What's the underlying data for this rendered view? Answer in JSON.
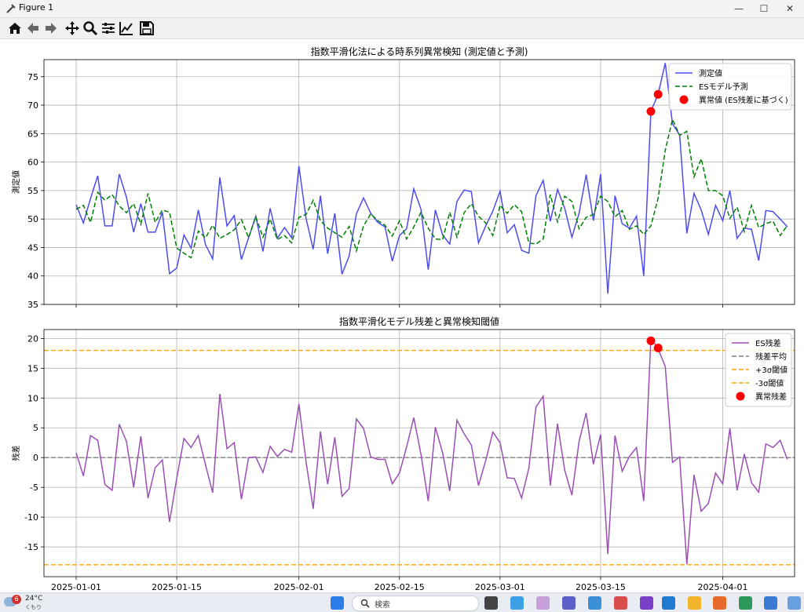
{
  "window": {
    "title": "Figure 1"
  },
  "toolbar": {
    "buttons": [
      "home-icon",
      "back-icon",
      "forward-icon",
      "pan-icon",
      "zoom-icon",
      "configure-subplots-icon",
      "edit-axis-icon",
      "save-icon"
    ]
  },
  "taskbar": {
    "weather_temp": "24°C",
    "weather_desc": "くもり",
    "weather_badge": "6",
    "search_placeholder": "検索"
  },
  "chart_data": [
    {
      "type": "line",
      "title": "指数平滑化法による時系列異常検知 (測定値と予測)",
      "ylabel": "測定値",
      "xlabel": "",
      "ylim": [
        35,
        78
      ],
      "yticks": [
        35,
        40,
        45,
        50,
        55,
        60,
        65,
        70,
        75
      ],
      "xticks": [
        "2025-01-01",
        "2025-01-15",
        "2025-02-01",
        "2025-02-15",
        "2025-03-01",
        "2025-03-15",
        "2025-04-01"
      ],
      "x_start": "2025-01-01",
      "legend_position": "top-right",
      "grid": true,
      "series": [
        {
          "name": "測定値",
          "color": "#4c4cf0",
          "style": "solid",
          "values": [
            52.5,
            49.3,
            53.6,
            57.6,
            48.8,
            48.8,
            57.9,
            53.8,
            47.7,
            52.7,
            47.7,
            47.7,
            51.2,
            40.4,
            41.4,
            47.2,
            44.9,
            51.6,
            45.5,
            43.0,
            57.3,
            48.8,
            50.6,
            42.9,
            46.7,
            50.5,
            44.3,
            51.9,
            46.6,
            48.5,
            46.7,
            59.3,
            50.1,
            44.7,
            54.1,
            43.9,
            51.0,
            40.3,
            43.5,
            50.9,
            53.7,
            51.0,
            49.4,
            48.6,
            42.6,
            47.1,
            48.3,
            55.3,
            51.7,
            41.1,
            51.6,
            47.2,
            45.6,
            53.1,
            55.1,
            54.8,
            45.8,
            48.8,
            51.4,
            54.9,
            47.6,
            49.0,
            44.5,
            44.0,
            54.1,
            56.8,
            49.6,
            55.2,
            51.9,
            46.8,
            51.0,
            57.8,
            49.7,
            57.9,
            36.9,
            54.1,
            49.2,
            48.4,
            50.5,
            40.0,
            68.9,
            71.9,
            77.4,
            66.7,
            64.8,
            47.5,
            54.5,
            51.6,
            47.3,
            52.4,
            49.7,
            55.0,
            46.6,
            48.4,
            48.2,
            42.7,
            51.5,
            51.3,
            50.0,
            48.6
          ]
        },
        {
          "name": "ESモデル予測",
          "color": "#008000",
          "style": "dashed",
          "values": [
            51.7,
            52.4,
            49.4,
            54.7,
            53.3,
            54.3,
            52.3,
            51.1,
            52.7,
            49.1,
            54.5,
            49.4,
            51.6,
            51.2,
            44.9,
            44.0,
            43.2,
            47.9,
            46.7,
            48.9,
            46.6,
            47.3,
            48.1,
            49.9,
            46.7,
            50.4,
            46.8,
            50.0,
            46.4,
            47.1,
            45.8,
            50.3,
            50.8,
            53.3,
            49.7,
            48.4,
            47.6,
            46.8,
            48.7,
            44.4,
            48.8,
            50.9,
            49.7,
            48.9,
            47.0,
            49.7,
            46.5,
            48.6,
            51.2,
            48.4,
            46.5,
            46.4,
            51.2,
            46.8,
            51.1,
            52.7,
            50.5,
            49.3,
            47.1,
            52.4,
            51.0,
            52.5,
            51.3,
            45.8,
            45.6,
            46.5,
            54.3,
            49.5,
            54.0,
            53.1,
            48.3,
            50.3,
            50.8,
            54.0,
            53.1,
            50.4,
            51.5,
            48.2,
            48.8,
            47.3,
            48.8,
            53.6,
            62.1,
            67.5,
            64.7,
            65.4,
            57.4,
            60.6,
            55.0,
            55.0,
            54.1,
            50.1,
            52.1,
            47.8,
            52.4,
            48.5,
            49.2,
            49.6,
            47.1,
            48.9
          ]
        }
      ],
      "anomalies": {
        "name": "異常値 (ES残差に基づく)",
        "color": "#ff0000",
        "points": [
          {
            "index": 80,
            "value": 68.9
          },
          {
            "index": 81,
            "value": 71.9
          }
        ]
      }
    },
    {
      "type": "line",
      "title": "指数平滑化モデル残差と異常検知閾値",
      "ylabel": "残差",
      "xlabel": "",
      "ylim": [
        -20,
        21.5
      ],
      "yticks": [
        -15,
        -10,
        -5,
        0,
        5,
        10,
        15,
        20
      ],
      "xticks": [
        "2025-01-01",
        "2025-01-15",
        "2025-02-01",
        "2025-02-15",
        "2025-03-01",
        "2025-03-15",
        "2025-04-01"
      ],
      "x_start": "2025-01-01",
      "legend_position": "top-right",
      "grid": true,
      "series": [
        {
          "name": "ES残差",
          "color": "#9b4fb5",
          "style": "solid",
          "values": [
            0.8,
            -3.1,
            3.7,
            2.9,
            -4.5,
            -5.5,
            5.6,
            2.7,
            -5.0,
            3.6,
            -6.8,
            -1.7,
            -0.4,
            -10.8,
            -3.5,
            3.2,
            1.7,
            3.7,
            -1.2,
            -5.9,
            10.7,
            1.5,
            2.5,
            -7.0,
            0.0,
            0.1,
            -2.5,
            1.9,
            0.2,
            1.4,
            0.9,
            9.0,
            -0.7,
            -8.6,
            4.4,
            -4.5,
            3.4,
            -6.5,
            -5.2,
            6.5,
            4.9,
            0.1,
            -0.3,
            -0.3,
            -4.4,
            -2.6,
            1.8,
            6.7,
            0.5,
            -7.3,
            5.1,
            0.8,
            -5.6,
            6.3,
            4.0,
            2.1,
            -4.7,
            -0.5,
            4.3,
            2.5,
            -3.4,
            -3.5,
            -6.8,
            -1.8,
            8.5,
            10.3,
            -4.7,
            5.7,
            -2.1,
            -6.3,
            2.7,
            7.5,
            -1.1,
            3.9,
            -16.2,
            3.7,
            -2.3,
            0.2,
            1.7,
            -7.3,
            20.1,
            18.3,
            15.3,
            -0.8,
            0.1,
            -17.9,
            -2.9,
            -9.0,
            -7.7,
            -2.6,
            -4.4,
            4.9,
            -5.5,
            0.6,
            -4.2,
            -5.8,
            2.3,
            1.7,
            2.9,
            -0.3
          ]
        }
      ],
      "reference_lines": [
        {
          "name": "残差平均",
          "value": 0,
          "color": "#808080",
          "style": "dashed"
        },
        {
          "name": "+3σ閾値",
          "value": 18.0,
          "color": "#ffa500",
          "style": "dashed"
        },
        {
          "name": "-3σ閾値",
          "value": -18.0,
          "color": "#ffa500",
          "style": "dashed"
        }
      ],
      "anomalies": {
        "name": "異常残差",
        "color": "#ff0000",
        "points": [
          {
            "index": 80,
            "value": 19.6
          },
          {
            "index": 81,
            "value": 18.4
          }
        ]
      }
    }
  ]
}
